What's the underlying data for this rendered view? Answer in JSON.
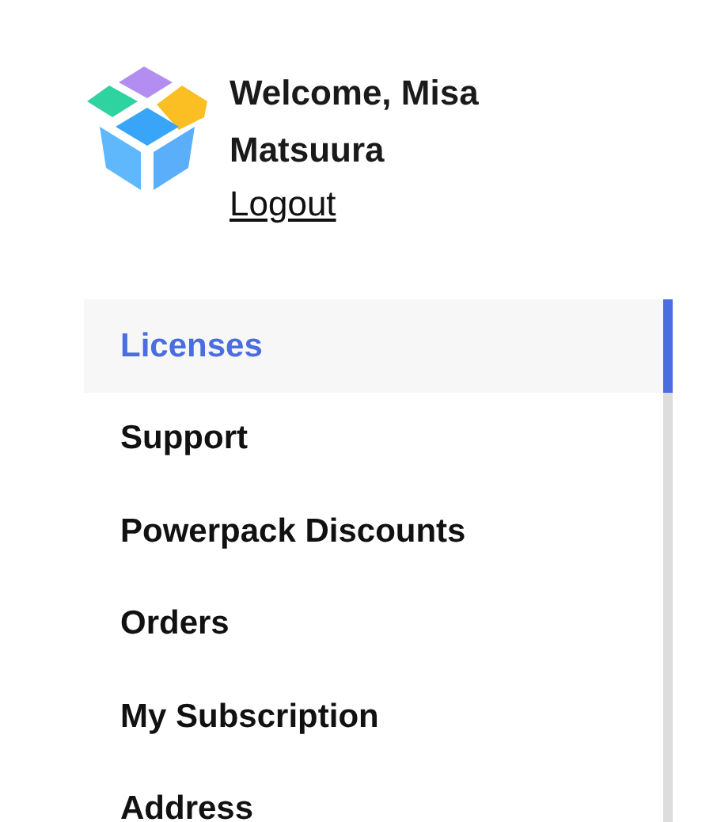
{
  "user": {
    "greeting": "Welcome, Misa Matsuura",
    "logout": "Logout"
  },
  "menu": [
    {
      "label": "Licenses",
      "selected": true
    },
    {
      "label": "Support",
      "selected": false
    },
    {
      "label": "Powerpack Discounts",
      "selected": false
    },
    {
      "label": "Orders",
      "selected": false
    },
    {
      "label": "My Subscription",
      "selected": false
    },
    {
      "label": "Address",
      "selected": false
    }
  ]
}
